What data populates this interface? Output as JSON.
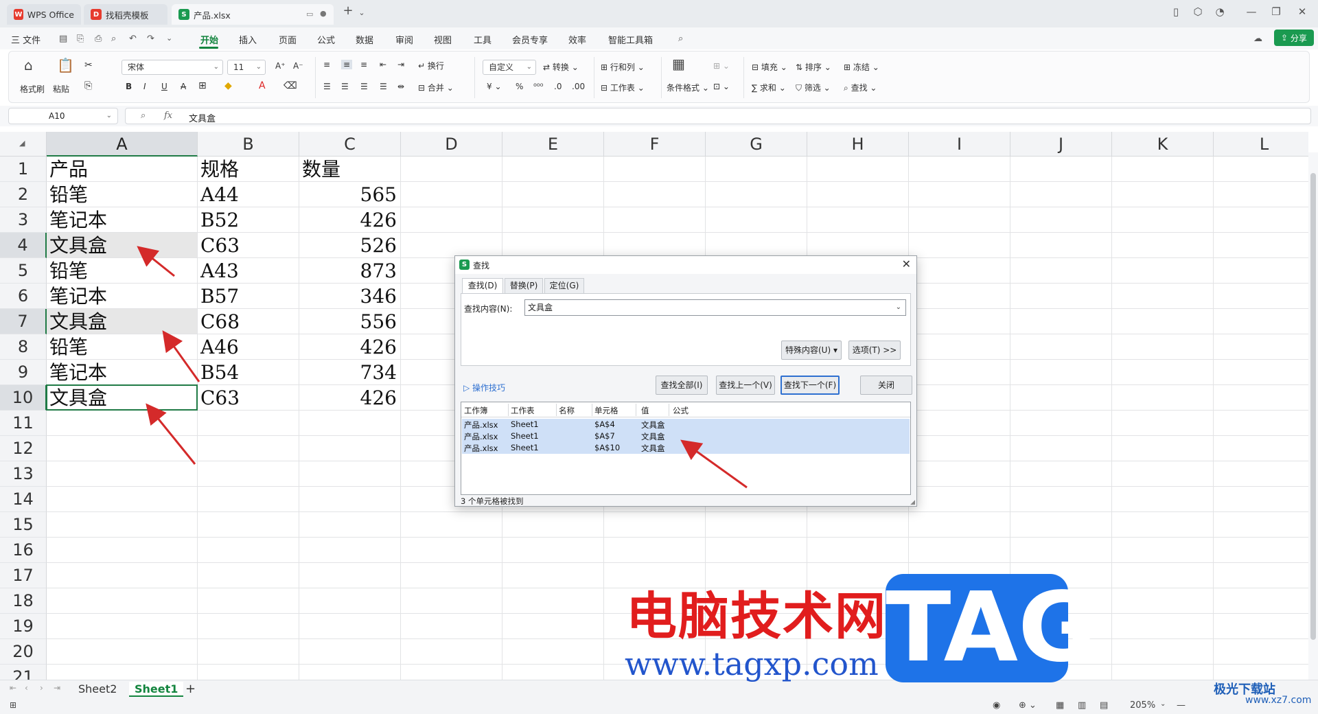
{
  "tabs": [
    {
      "label": "WPS Office",
      "logo": "W",
      "color": "#e63b2e"
    },
    {
      "label": "找稻壳模板",
      "logo": "D",
      "color": "#e63b2e"
    },
    {
      "label": "产品.xlsx",
      "logo": "S",
      "color": "#1a9a50"
    }
  ],
  "menu": {
    "file": "三 文件",
    "items": [
      "开始",
      "插入",
      "页面",
      "公式",
      "数据",
      "审阅",
      "视图",
      "工具",
      "会员专享",
      "效率",
      "智能工具箱"
    ],
    "active": "开始",
    "share": "分享"
  },
  "ribbon": {
    "format_painter": "格式刷",
    "paste": "粘贴",
    "font_name": "宋体",
    "font_size": "11",
    "wrap": "换行",
    "merge": "合并",
    "number_format": "自定义",
    "convert": "转换",
    "rows_cols": "行和列",
    "worksheet": "工作表",
    "cond_format": "条件格式",
    "fill": "填充",
    "sort": "排序",
    "freeze": "冻结",
    "sum": "求和",
    "filter": "筛选",
    "find": "查找"
  },
  "formula_bar": {
    "cell_ref": "A10",
    "fx": "fx",
    "content": "文具盒"
  },
  "columns": [
    "A",
    "B",
    "C",
    "D",
    "E",
    "F",
    "G",
    "H",
    "I",
    "J",
    "K",
    "L"
  ],
  "rows": [
    "1",
    "2",
    "3",
    "4",
    "5",
    "6",
    "7",
    "8",
    "9",
    "10",
    "11",
    "12",
    "13",
    "14",
    "15",
    "16",
    "17",
    "18",
    "19",
    "20",
    "21"
  ],
  "table": [
    [
      "产品",
      "规格",
      "数量"
    ],
    [
      "铅笔",
      "A44",
      "565"
    ],
    [
      "笔记本",
      "B52",
      "426"
    ],
    [
      "文具盒",
      "C63",
      "526"
    ],
    [
      "铅笔",
      "A43",
      "873"
    ],
    [
      "笔记本",
      "B57",
      "346"
    ],
    [
      "文具盒",
      "C68",
      "556"
    ],
    [
      "铅笔",
      "A46",
      "426"
    ],
    [
      "笔记本",
      "B54",
      "734"
    ],
    [
      "文具盒",
      "C63",
      "426"
    ]
  ],
  "sheets": [
    "Sheet2",
    "Sheet1"
  ],
  "active_sheet": "Sheet1",
  "status": {
    "zoom": "205%"
  },
  "find_dialog": {
    "title": "查找",
    "tabs": [
      "查找(D)",
      "替换(P)",
      "定位(G)"
    ],
    "find_label": "查找内容(N):",
    "find_value": "文具盒",
    "special_btn": "特殊内容(U) ▾",
    "options_btn": "选项(T) >>",
    "tips_link": "操作技巧",
    "find_all": "查找全部(I)",
    "find_prev": "查找上一个(V)",
    "find_next": "查找下一个(F)",
    "close": "关闭",
    "result_headers": [
      "工作簿",
      "工作表",
      "名称",
      "单元格",
      "值",
      "公式"
    ],
    "results": [
      [
        "产品.xlsx",
        "Sheet1",
        "",
        "$A$4",
        "文具盒",
        ""
      ],
      [
        "产品.xlsx",
        "Sheet1",
        "",
        "$A$7",
        "文具盒",
        ""
      ],
      [
        "产品.xlsx",
        "Sheet1",
        "",
        "$A$10",
        "文具盒",
        ""
      ]
    ],
    "status_text": "3 个单元格被找到"
  },
  "watermark": {
    "site_name": "电脑技术网",
    "url": "www.tagxp.com",
    "tag": "TAG",
    "corner_name": "极光下载站",
    "corner_url": "www.xz7.com"
  }
}
